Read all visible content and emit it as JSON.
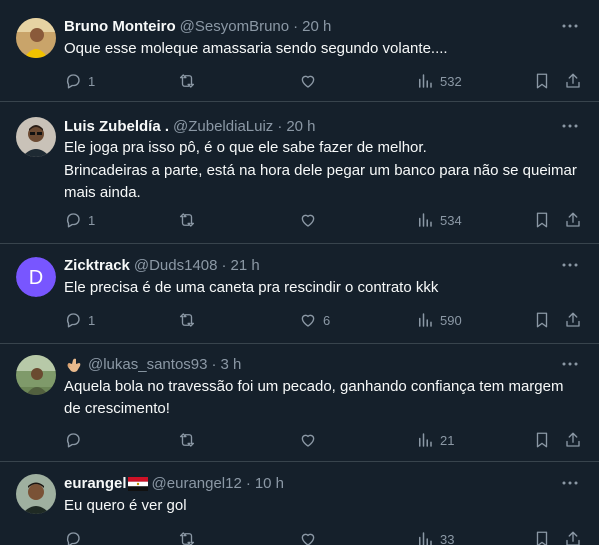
{
  "tweets": [
    {
      "name": "Bruno Monteiro",
      "handle": "@SesyomBruno",
      "sep": "·",
      "time": "20 h",
      "text": "Oque esse moleque amassaria sendo segundo volante....",
      "replies": "1",
      "retweets": "",
      "likes": "",
      "views": "532",
      "avatar_icon": "profile-photo"
    },
    {
      "name": "Luis Zubeldía .",
      "handle": "@ZubeldiaLuiz",
      "sep": "·",
      "time": "20 h",
      "text": "Ele joga pra isso pô, é o que ele sabe fazer de melhor.\nBrincadeiras a parte, está na hora dele pegar um banco para não se queimar mais ainda.",
      "replies": "1",
      "retweets": "",
      "likes": "",
      "views": "534",
      "avatar_icon": "profile-photo"
    },
    {
      "name": "Zicktrack",
      "handle": "@Duds1408",
      "sep": "·",
      "time": "21 h",
      "text": "Ele precisa é de uma caneta pra rescindir o contrato kkk",
      "replies": "1",
      "retweets": "",
      "likes": "6",
      "views": "590",
      "avatar_letter": "D",
      "avatar_color": "#7856ff"
    },
    {
      "name": "",
      "handle": "@lukas_santos93",
      "sep": "·",
      "time": "3 h",
      "text": "Aquela bola no travessão foi um pecado, ganhando confiança tem margem de crescimento!",
      "replies": "",
      "retweets": "",
      "likes": "",
      "views": "21",
      "name_icon": "call-me-hand-emoji",
      "avatar_icon": "profile-photo"
    },
    {
      "name": "eurangel",
      "handle": "@eurangel12",
      "sep": "·",
      "time": "10 h",
      "text": "Eu quero é ver gol",
      "replies": "",
      "retweets": "",
      "likes": "",
      "views": "33",
      "name_icon": "flag-egypt-emoji",
      "avatar_icon": "profile-photo"
    }
  ],
  "colors": {
    "background": "#15202b",
    "text": "#f7f9f9",
    "secondary": "#8b98a5",
    "divider": "#38444d"
  }
}
